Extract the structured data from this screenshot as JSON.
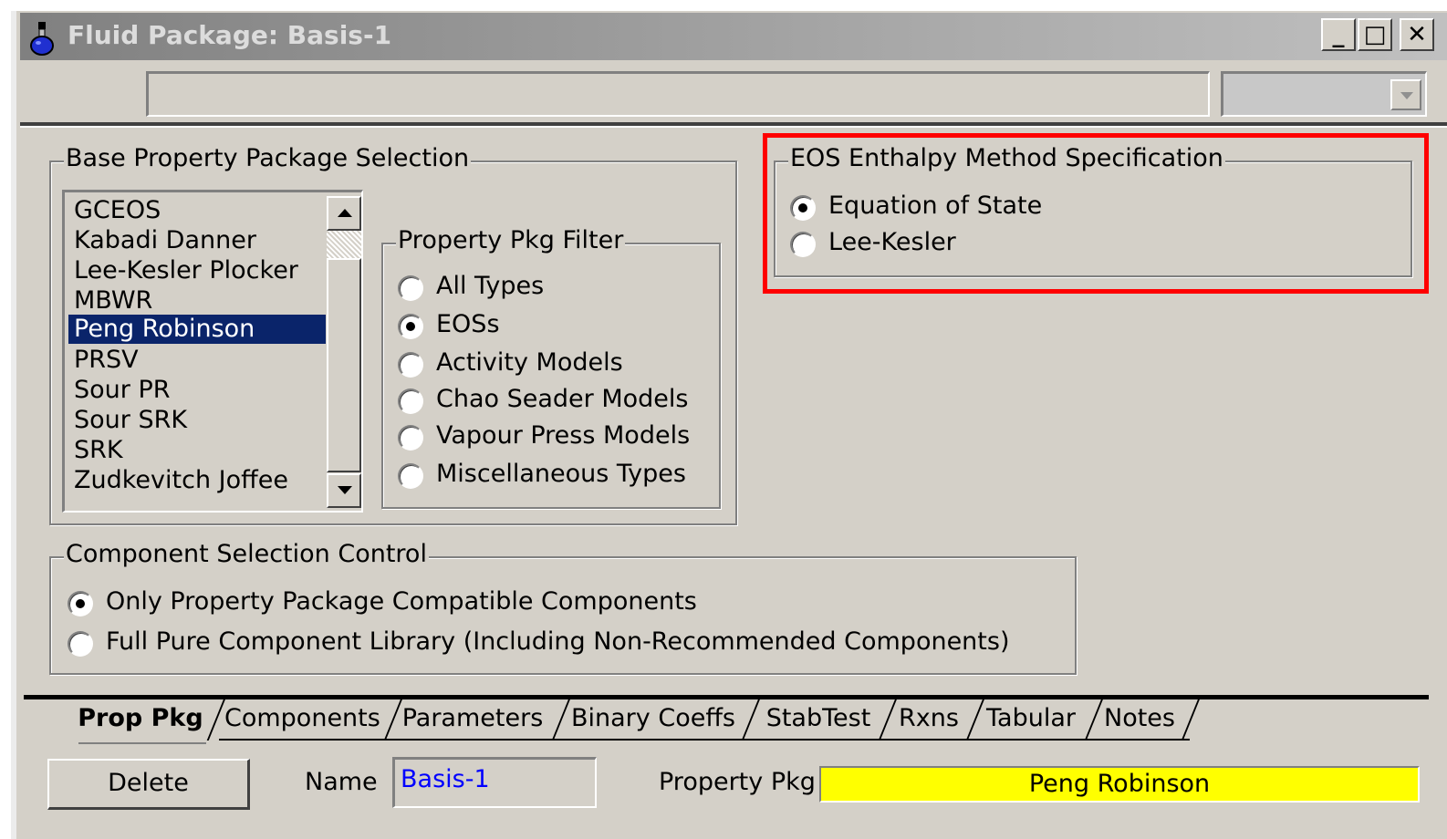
{
  "window": {
    "title": "Fluid Package: Basis-1",
    "minimize_label": "_",
    "maximize_label": "□",
    "close_label": "✕"
  },
  "base_package": {
    "label": "Base Property Package Selection",
    "items": [
      "GCEOS",
      "Kabadi Danner",
      "Lee-Kesler Plocker",
      "MBWR",
      "Peng Robinson",
      "PRSV",
      "Sour PR",
      "Sour SRK",
      "SRK",
      "Zudkevitch Joffee"
    ],
    "selected": "Peng Robinson"
  },
  "filter": {
    "label": "Property Pkg Filter",
    "options": [
      "All Types",
      "EOSs",
      "Activity Models",
      "Chao Seader Models",
      "Vapour Press Models",
      "Miscellaneous Types"
    ],
    "selected": "EOSs"
  },
  "eos": {
    "label": "EOS Enthalpy Method Specification",
    "options": [
      "Equation of State",
      "Lee-Kesler"
    ],
    "selected": "Equation of State"
  },
  "component_control": {
    "label": "Component Selection Control",
    "options": [
      "Only Property Package Compatible Components",
      "Full Pure Component Library (Including Non-Recommended Components)"
    ],
    "selected": "Only Property Package Compatible Components"
  },
  "tabs": [
    "Prop Pkg",
    "Components",
    "Parameters",
    "Binary Coeffs",
    "StabTest",
    "Rxns",
    "Tabular",
    "Notes"
  ],
  "active_tab": "Prop Pkg",
  "bottom": {
    "delete_label": "Delete",
    "name_label": "Name",
    "name_value": "Basis-1",
    "pkg_label": "Property Pkg",
    "pkg_value": "Peng Robinson"
  },
  "colors": {
    "highlight": "#ff0000",
    "selection": "#0a246a",
    "pkg_field_bg": "#ffff00",
    "name_text": "#0000ff"
  },
  "icons": {
    "title_icon": "flask-icon"
  }
}
